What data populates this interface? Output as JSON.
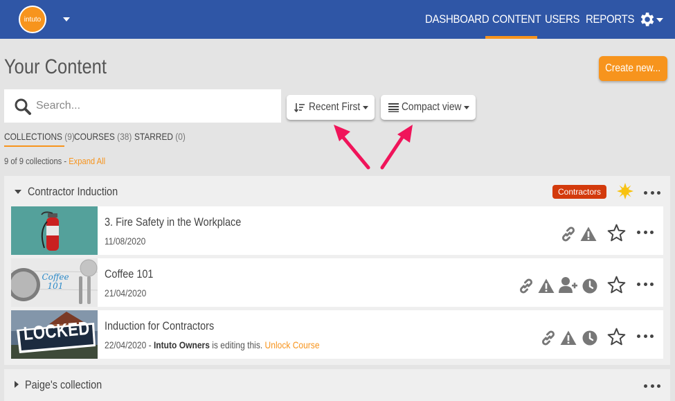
{
  "app": {
    "logo_text": "intuto",
    "nav": [
      {
        "label": "DASHBOARD"
      },
      {
        "label": "CONTENT"
      },
      {
        "label": "USERS"
      },
      {
        "label": "REPORTS"
      }
    ],
    "active_nav": "CONTENT",
    "accent_color": "#f7941d",
    "nav_color": "#2f56a6"
  },
  "page": {
    "title": "Your Content",
    "create_label": "Create new..."
  },
  "search": {
    "placeholder": "Search...",
    "value": ""
  },
  "sort": {
    "label": "Recent First"
  },
  "view": {
    "label": "Compact view"
  },
  "tabs": [
    {
      "label": "COLLECTIONS",
      "count": "(9)"
    },
    {
      "label": "COURSES",
      "count": "(38)"
    },
    {
      "label": "STARRED",
      "count": "(0)"
    }
  ],
  "summary": {
    "text": "9 of 9 collections -",
    "expand_label": "Expand All"
  },
  "collections": [
    {
      "name": "Contractor Induction",
      "tag": "Contractors",
      "tag_color": "#d33a0c",
      "courses": [
        {
          "title": "3. Fire Safety in the Workplace",
          "date": "11/08/2020",
          "icons": [
            "link-icon",
            "warning-icon",
            "star-icon",
            "more-icon"
          ]
        },
        {
          "title": "Coffee 101",
          "thumb_text": "Coffee 101",
          "date": "21/04/2020",
          "icons": [
            "link-icon",
            "warning-icon",
            "add-user-icon",
            "clock-icon",
            "star-icon",
            "more-icon"
          ]
        },
        {
          "title": "Induction for Contractors",
          "thumb_text": "LOCKED",
          "date": "22/04/2020 -",
          "editor": "Intuto Owners",
          "editing_text": "is editing this.",
          "unlock_label": "Unlock Course",
          "icons": [
            "link-icon",
            "warning-icon",
            "clock-icon",
            "star-icon",
            "more-icon"
          ]
        }
      ]
    },
    {
      "name": "Paige's collection"
    }
  ]
}
